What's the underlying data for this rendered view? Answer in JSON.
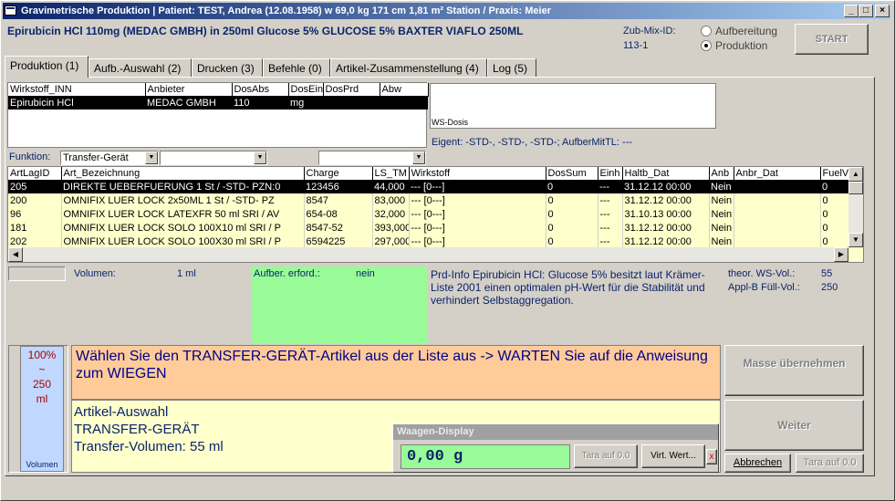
{
  "window": {
    "title": "Gravimetrische Produktion  |  Patient: TEST, Andrea (12.08.1958) w 69,0 kg  171 cm  1,81 m² Station / Praxis: Meier",
    "min": "_",
    "max": "□",
    "close": "×"
  },
  "header": {
    "product": "Epirubicin HCl 110mg (MEDAC GMBH) in 250ml Glucose 5% GLUCOSE 5% BAXTER VIAFLO 250ML",
    "zub_mix_label": "Zub-Mix-ID:",
    "zub_mix_value": "113-1",
    "radio_aufbereitung": "Aufbereitung",
    "radio_produktion": "Produktion",
    "start": "START"
  },
  "tabs": [
    {
      "label": "Produktion (1)"
    },
    {
      "label": "Aufb.-Auswahl (2)"
    },
    {
      "label": "Drucken (3)"
    },
    {
      "label": "Befehle (0)"
    },
    {
      "label": "Artikel-Zusammenstellung (4)"
    },
    {
      "label": "Log (5)"
    }
  ],
  "wirkstoff_table": {
    "headers": [
      "Wirkstoff_INN",
      "Anbieter",
      "DosAbs",
      "DosEin",
      "DosPrd",
      "Abw"
    ],
    "row": [
      "Epirubicin HCl",
      "MEDAC GMBH",
      "110",
      "mg",
      "",
      ""
    ]
  },
  "ws_dosis_label": "WS-Dosis",
  "eigent": "Eigent: -STD-, -STD-, -STD-; AufberMitTL: ---",
  "funktion": {
    "label": "Funktion:",
    "value": "Transfer-Gerät"
  },
  "article_table": {
    "headers": [
      "ArtLagID",
      "Art_Bezeichnung",
      "Charge",
      "LS_TM",
      "Wirkstoff",
      "DosSum",
      "Einh",
      "Haltb_Dat",
      "Anb",
      "Anbr_Dat",
      "FuelV"
    ],
    "rows": [
      [
        "205",
        "DIREKTE UEBERFUERUNG  1 St   / -STD- PZN:0",
        "123456",
        "44,000",
        "--- [0---]",
        "0",
        "---",
        "31.12.12 00:00",
        "Nein",
        "",
        "0"
      ],
      [
        "200",
        "OMNIFIX LUER LOCK 2x50ML   1 St   / -STD- PZ",
        "8547",
        "83,000",
        "--- [0---]",
        "0",
        "---",
        "31.12.12 00:00",
        "Nein",
        "",
        "0"
      ],
      [
        "96",
        "OMNIFIX LUER LOCK LATEXFR   50 ml SRI  / AV",
        "654-08",
        "32,000",
        "--- [0---]",
        "0",
        "---",
        "31.10.13 00:00",
        "Nein",
        "",
        "0"
      ],
      [
        "181",
        "OMNIFIX LUER LOCK SOLO   100X10 ml SRI  / P",
        "8547-52",
        "393,000",
        "--- [0---]",
        "0",
        "---",
        "31.12.12 00:00",
        "Nein",
        "",
        "0"
      ],
      [
        "202",
        "OMNIFIX LUER LOCK SOLO   100X30 ml SRI  / P",
        "6594225",
        "297,000",
        "--- [0---]",
        "0",
        "---",
        "31.12.12 00:00",
        "Nein",
        "",
        "0"
      ]
    ]
  },
  "info": {
    "volumen_label": "Volumen:",
    "volumen_value": "1 ml",
    "aufber_label": "Aufber. erford.:",
    "aufber_value": "nein",
    "prd_info": "Prd-Info Epirubicin HCl: Glucose 5% besitzt laut Krämer-Liste 2001 einen optimalen pH-Wert für die Stabilität und verhindert Selbstaggregation.",
    "theor_label": "theor. WS-Vol.:",
    "theor_value": "55",
    "applb_label": "Appl-B Füll-Vol.:",
    "applb_value": "250"
  },
  "gauge": {
    "percent": "100%",
    "tilde": "~",
    "amount": "250",
    "unit": "ml",
    "label": "Volumen",
    "fill_fraction": 1.0
  },
  "instruction": "Wählen Sie den TRANSFER-GERÄT-Artikel aus der Liste aus -> WARTEN Sie auf die Anweisung zum WIEGEN",
  "auswahl": {
    "line1": "Artikel-Auswahl",
    "line2": "TRANSFER-GERÄT",
    "line3": "Transfer-Volumen: 55 ml"
  },
  "waage": {
    "title": "Waagen-Display",
    "value": "0,00  g",
    "tara": "Tara auf 0.0",
    "virt": "Virt. Wert...",
    "x": "x"
  },
  "buttons": {
    "masse": "Masse übernehmen",
    "weiter": "Weiter",
    "abbrechen": "Abbrechen",
    "tara": "Tara auf 0.0"
  },
  "colors": {
    "title_start": "#0a246a",
    "info_green": "#98fb98",
    "instruction_bg": "#ffcc99",
    "gauge_bg": "#c0d8ff",
    "row_bg": "#ffffcc"
  }
}
